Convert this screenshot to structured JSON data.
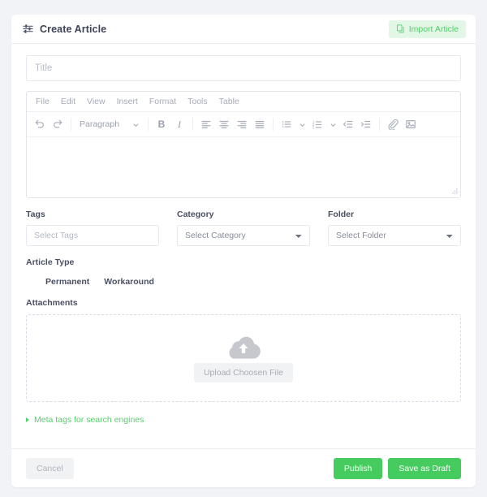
{
  "header": {
    "title": "Create Article",
    "title_icon": "sliders-icon",
    "import_button": {
      "label": "Import Article",
      "icon": "copy-icon",
      "bg_color": "#e3f7e6",
      "text_color": "#54cc6a"
    }
  },
  "form": {
    "title_field": {
      "label": "Title",
      "placeholder": "Title",
      "value": ""
    },
    "editor": {
      "menubar": [
        {
          "label": "File"
        },
        {
          "label": "Edit"
        },
        {
          "label": "View"
        },
        {
          "label": "Insert"
        },
        {
          "label": "Format"
        },
        {
          "label": "Tools"
        },
        {
          "label": "Table"
        }
      ],
      "toolbar": {
        "undo": "undo-icon",
        "redo": "redo-icon",
        "block_format": "Paragraph",
        "bold": "B",
        "italic": "I",
        "align_left": "align-left-icon",
        "align_center": "align-center-icon",
        "align_right": "align-right-icon",
        "align_justify": "align-justify-icon",
        "bullet_list": "bullet-list-icon",
        "numbered_list": "numbered-list-icon",
        "outdent": "outdent-icon",
        "indent": "indent-icon",
        "link": "paperclip-icon",
        "image": "image-icon"
      },
      "content": ""
    },
    "tags": {
      "label": "Tags",
      "placeholder": "Select Tags",
      "value": ""
    },
    "category": {
      "label": "Category",
      "selected": "Select Category",
      "options": [
        "Select Category"
      ]
    },
    "folder": {
      "label": "Folder",
      "selected": "Select Folder",
      "options": [
        "Select Folder"
      ]
    },
    "article_type": {
      "label": "Article Type",
      "options": [
        {
          "label": "Permanent",
          "selected": false
        },
        {
          "label": "Workaround",
          "selected": false
        }
      ]
    },
    "attachments": {
      "label": "Attachments",
      "dropzone_icon": "cloud-upload-icon",
      "upload_button": "Upload Choosen File"
    },
    "meta_tags": {
      "label": "Meta tags for search engines",
      "expanded": false,
      "color": "#57cf6c"
    }
  },
  "footer": {
    "cancel": "Cancel",
    "publish": "Publish",
    "save_draft": "Save as Draft",
    "accent_color": "#46cc5e"
  }
}
